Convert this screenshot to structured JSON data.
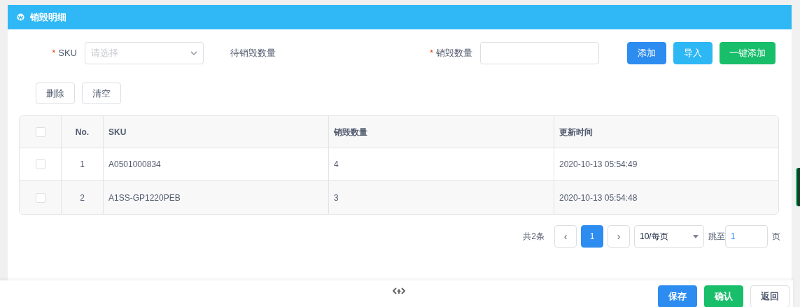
{
  "panel": {
    "title": "销毁明细"
  },
  "form": {
    "sku": {
      "required_mark": "*",
      "label": "SKU",
      "placeholder": "请选择"
    },
    "pending_label": "待销毁数量",
    "quantity": {
      "required_mark": "*",
      "label": "销毁数量"
    },
    "buttons": [
      {
        "label": "添加",
        "kind": "primary"
      },
      {
        "label": "导入",
        "kind": "info"
      },
      {
        "label": "一键添加",
        "kind": "success"
      }
    ]
  },
  "actions": [
    {
      "label": "删除",
      "kind": "default"
    },
    {
      "label": "清空",
      "kind": "default"
    }
  ],
  "table": {
    "select_all": {
      "checked": false
    },
    "columns": [
      "No.",
      "SKU",
      "销毁数量",
      "更新时间"
    ],
    "rows": [
      {
        "checked": false,
        "cells": [
          "1",
          "A0501000834",
          "4",
          "2020-10-13 05:54:49"
        ]
      },
      {
        "checked": false,
        "cells": [
          "2",
          "A1SS-GP1220PEB",
          "3",
          "2020-10-13 05:54:48"
        ]
      }
    ]
  },
  "pagination": {
    "total": "共2条",
    "prev": "‹",
    "pages": [
      {
        "label": "1",
        "selected": true
      }
    ],
    "next": "›",
    "page_size": "10/每页",
    "jump_label": "跳至",
    "jump_value": "1",
    "page_suffix": "页"
  },
  "footer": {
    "buttons": [
      {
        "label": "保存",
        "kind": "primary"
      },
      {
        "label": "确认",
        "kind": "success"
      },
      {
        "label": "返回",
        "kind": "default"
      }
    ]
  }
}
